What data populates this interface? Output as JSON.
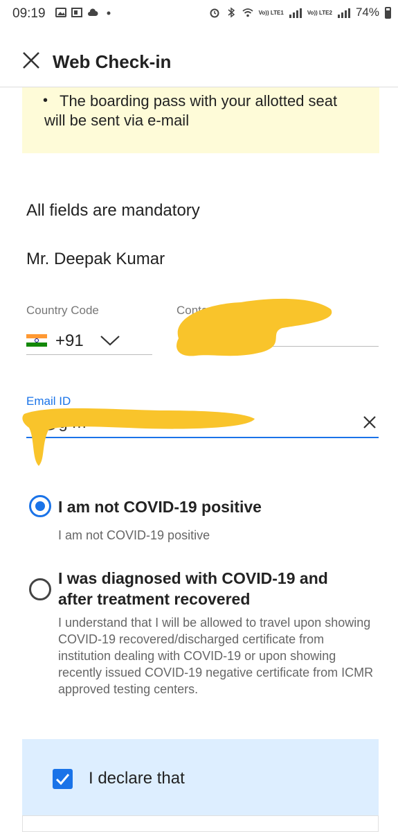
{
  "status_bar": {
    "time": "09:19",
    "battery": "74%",
    "lte1": "Vo)) LTE1",
    "lte2": "Vo)) LTE2"
  },
  "header": {
    "title": "Web Check-in"
  },
  "note": {
    "text": "The boarding pass with your allotted seat will be sent via e-mail"
  },
  "form": {
    "mandatory_text": "All fields are mandatory",
    "passenger_name": "Mr. Deepak Kumar",
    "country_code_label": "Country Code",
    "country_code_value": "+91",
    "contact_label": "Conta",
    "email_label": "Email ID",
    "email_value": "d       @g       m"
  },
  "covid_options": [
    {
      "title": "I am not COVID-19 positive",
      "description": "I am not COVID-19 positive",
      "selected": true
    },
    {
      "title": "I was diagnosed with COVID-19 and after treatment recovered",
      "description": "I understand that I will be allowed to travel upon showing COVID-19 recovered/discharged certificate from institution dealing with COVID-19 or upon showing recently issued COVID-19 negative certificate from ICMR approved testing centers.",
      "selected": false
    }
  ],
  "declaration": {
    "label": "I declare that",
    "checked": true
  },
  "colors": {
    "accent": "#1a73e8",
    "note_bg": "#fefbd8",
    "declare_bg": "#ddeeff",
    "redaction": "#f9c42b"
  },
  "icons": [
    "close-icon",
    "chevron-down-icon",
    "clear-icon",
    "india-flag-icon",
    "checkmark-icon"
  ]
}
